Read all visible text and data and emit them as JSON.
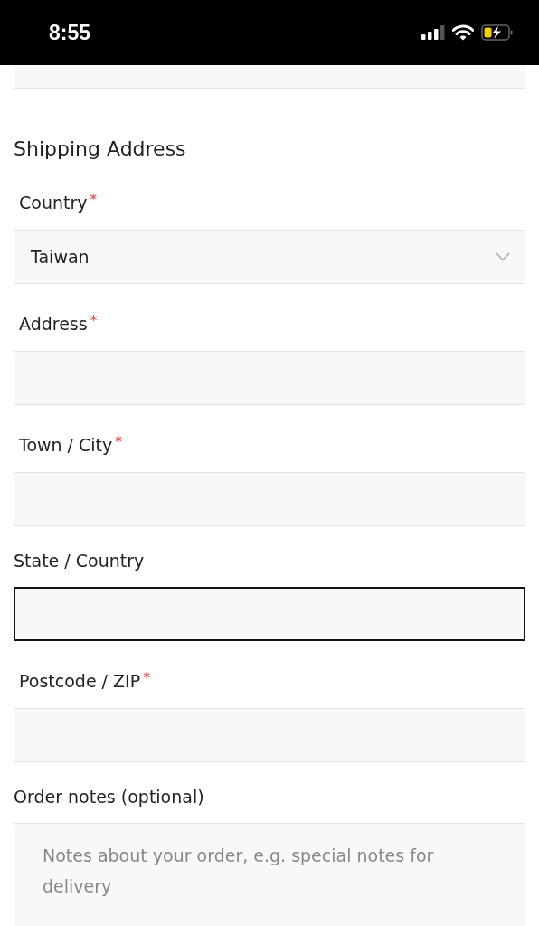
{
  "status_bar": {
    "time": "8:55"
  },
  "section_title": "Shipping Address",
  "fields": [
    {
      "kind": "select",
      "label": "Country",
      "required_mark": "*",
      "value": "Taiwan",
      "focused": false
    },
    {
      "kind": "text",
      "label": "Address",
      "required_mark": "*",
      "focused": false
    },
    {
      "kind": "text",
      "label": "Town / City",
      "required_mark": "*",
      "focused": false
    },
    {
      "kind": "text",
      "label": "State / Country",
      "focused": true
    },
    {
      "kind": "text",
      "label": "Postcode / ZIP",
      "required_mark": "*",
      "focused": false
    },
    {
      "kind": "textarea",
      "label": "Order notes (optional)",
      "placeholder": "Notes about your order, e.g. special notes for delivery",
      "focused": false
    }
  ]
}
